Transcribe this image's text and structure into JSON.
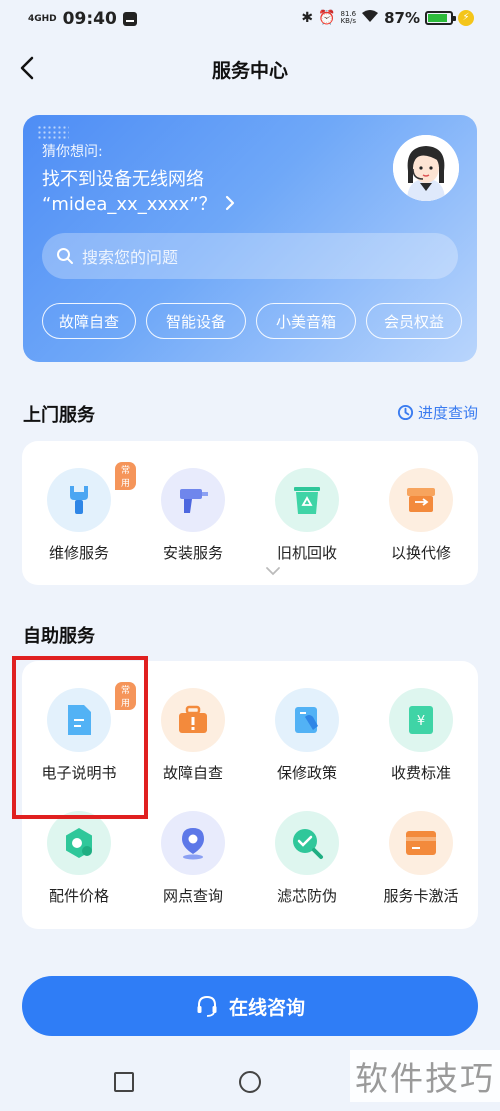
{
  "status_bar": {
    "network": "4GHD",
    "time": "09:40",
    "speed_value": "81.6",
    "speed_unit": "KB/s",
    "battery": "87%"
  },
  "header": {
    "title": "服务中心"
  },
  "hero": {
    "guess_label": "猜你想问:",
    "question_line1": "找不到设备无线网络",
    "question_line2": "“midea_xx_xxxx”？",
    "search_placeholder": "搜索您的问题",
    "chips": [
      "故障自查",
      "智能设备",
      "小美音箱",
      "会员权益"
    ]
  },
  "onsite": {
    "title": "上门服务",
    "progress_link": "进度查询",
    "badge": "常用",
    "items": [
      "维修服务",
      "安装服务",
      "旧机回收",
      "以换代修"
    ]
  },
  "self_service": {
    "title": "自助服务",
    "badge": "常用",
    "items": [
      "电子说明书",
      "故障自查",
      "保修政策",
      "收费标准",
      "配件价格",
      "网点查询",
      "滤芯防伪",
      "服务卡激活"
    ]
  },
  "bottom": {
    "consult_label": "在线咨询"
  },
  "watermark": "软件技巧",
  "colors": {
    "accent": "#2f7df6",
    "highlight": "#e02020",
    "badge": "#f5955a"
  }
}
